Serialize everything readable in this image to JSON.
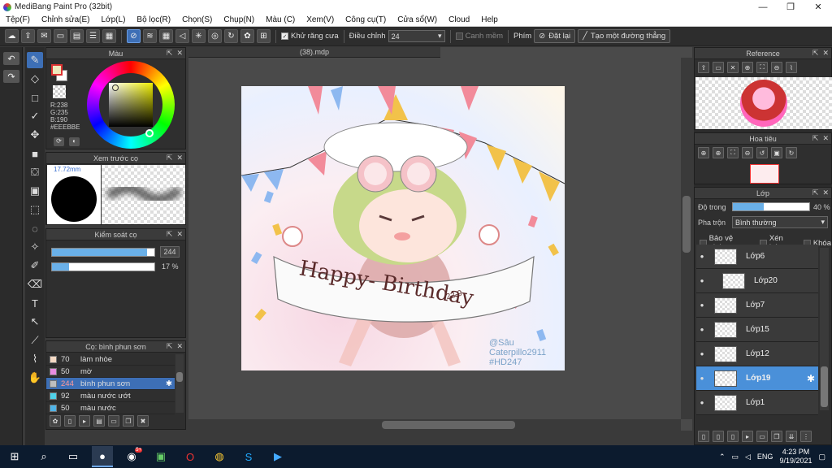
{
  "window": {
    "title": "MediBang Paint Pro (32bit)",
    "minimize": "—",
    "maximize": "❐",
    "close": "✕"
  },
  "menu": [
    "Tệp(F)",
    "Chỉnh sửa(E)",
    "Lớp(L)",
    "Bộ lọc(R)",
    "Chọn(S)",
    "Chụp(N)",
    "Màu (C)",
    "Xem(V)",
    "Công cụ(T)",
    "Cửa sổ(W)",
    "Cloud",
    "Help"
  ],
  "toolbar": {
    "antialias_label": "Khử răng cưa",
    "adjust_label": "Điều chỉnh",
    "adjust_value": "24",
    "smooth_label": "Canh mềm",
    "key_label": "Phím",
    "reset_label": "Đặt lại",
    "straight_label": "Tạo một đường thẳng"
  },
  "color_panel": {
    "title": "Màu",
    "r": "R:238",
    "g": "G:235",
    "b": "B:190",
    "hex": "#EEEBBE",
    "primary_color": "#eeebbe",
    "secondary_color": "#ffffff"
  },
  "brush_preview": {
    "title": "Xem trước cọ",
    "size": "17.72mm"
  },
  "brush_control": {
    "title": "Kiểm soát cọ",
    "size_value": "244",
    "size_fraction": 0.93,
    "opacity_value": "17 %",
    "opacity_fraction": 0.17
  },
  "brush_list": {
    "title": "Cọ: bình phun sơn",
    "items": [
      {
        "num": "70",
        "name": "làm nhòe",
        "color": "#f4d9c4"
      },
      {
        "num": "50",
        "name": "mờ",
        "color": "#e98ce0"
      },
      {
        "num": "244",
        "name": "bình phun sơn",
        "color": "#bfbfbf"
      },
      {
        "num": "92",
        "name": "màu nước ướt",
        "color": "#4fd1e8"
      },
      {
        "num": "50",
        "name": "màu nước",
        "color": "#4fb4e8"
      }
    ]
  },
  "canvas": {
    "tab_label": "(38).mdp"
  },
  "artwork": {
    "text_main": "Happy- Birthday",
    "date": "22-9",
    "signature": [
      "@Sâu",
      "Caterpillo2911",
      "#HD247"
    ]
  },
  "reference_panel": {
    "title": "Reference"
  },
  "navigator_panel": {
    "title": "Hoa tiêu"
  },
  "layer_panel": {
    "title": "Lớp",
    "opacity_label": "Độ trong",
    "opacity_value": "40 %",
    "opacity_fraction": 0.4,
    "blend_label": "Pha trộn",
    "blend_value": "Bình thường",
    "protect_alpha": "Bảo vệ alpha",
    "clipping": "Xén bớt",
    "lock": "Khóa",
    "layers": [
      {
        "name": "Lớp6",
        "indent": false,
        "selected": false
      },
      {
        "name": "Lớp20",
        "indent": true,
        "selected": false
      },
      {
        "name": "Lớp7",
        "indent": false,
        "selected": false
      },
      {
        "name": "Lớp15",
        "indent": false,
        "selected": false
      },
      {
        "name": "Lớp12",
        "indent": false,
        "selected": false
      },
      {
        "name": "Lớp19",
        "indent": false,
        "selected": true
      },
      {
        "name": "Lớp1",
        "indent": false,
        "selected": false
      }
    ]
  },
  "taskbar": {
    "lang": "ENG",
    "time": "4:23 PM",
    "date": "9/19/2021",
    "badge": "5+"
  }
}
